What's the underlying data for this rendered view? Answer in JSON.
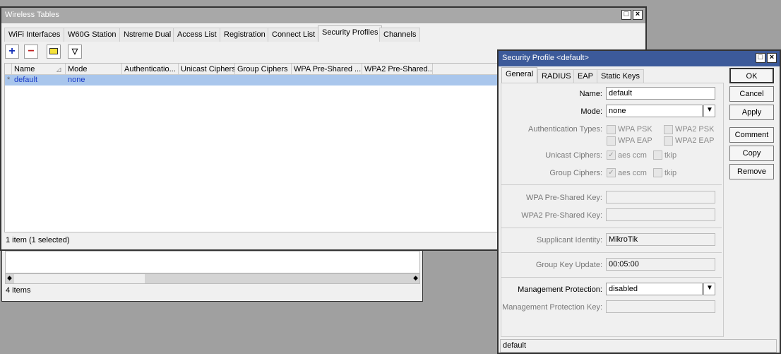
{
  "main_window": {
    "title": "Wireless Tables",
    "tabs": [
      "WiFi Interfaces",
      "W60G Station",
      "Nstreme Dual",
      "Access List",
      "Registration",
      "Connect List",
      "Security Profiles",
      "Channels"
    ],
    "active_tab": "Security Profiles",
    "toolbar": {
      "add": "+",
      "remove": "−",
      "comment": "comment-icon",
      "filter": "filter-icon"
    },
    "columns": [
      "Name",
      "Mode",
      "Authenticatio...",
      "Unicast Ciphers",
      "Group Ciphers",
      "WPA Pre-Shared ...",
      "WPA2 Pre-Shared..."
    ],
    "rows": [
      {
        "marker": "*",
        "name": "default",
        "mode": "none"
      }
    ],
    "status": "1 item (1 selected)"
  },
  "back_window": {
    "status": "4 items"
  },
  "dialog": {
    "title": "Security Profile <default>",
    "tabs": [
      "General",
      "RADIUS",
      "EAP",
      "Static Keys"
    ],
    "active_tab": "General",
    "buttons": [
      "OK",
      "Cancel",
      "Apply",
      "Comment",
      "Copy",
      "Remove"
    ],
    "fields": {
      "name_label": "Name:",
      "name": "default",
      "mode_label": "Mode:",
      "mode": "none",
      "auth_label": "Authentication Types:",
      "wpa_psk": "WPA PSK",
      "wpa2_psk": "WPA2 PSK",
      "wpa_eap": "WPA EAP",
      "wpa2_eap": "WPA2 EAP",
      "unicast_label": "Unicast Ciphers:",
      "group_label": "Group Ciphers:",
      "aes": "aes ccm",
      "tkip": "tkip",
      "wpa_key_label": "WPA Pre-Shared Key:",
      "wpa2_key_label": "WPA2 Pre-Shared Key:",
      "supplicant_label": "Supplicant Identity:",
      "supplicant": "MikroTik",
      "gku_label": "Group Key Update:",
      "gku": "00:05:00",
      "mgmt_label": "Management Protection:",
      "mgmt": "disabled",
      "mgmt_key_label": "Management Protection Key:"
    },
    "status": "default"
  }
}
